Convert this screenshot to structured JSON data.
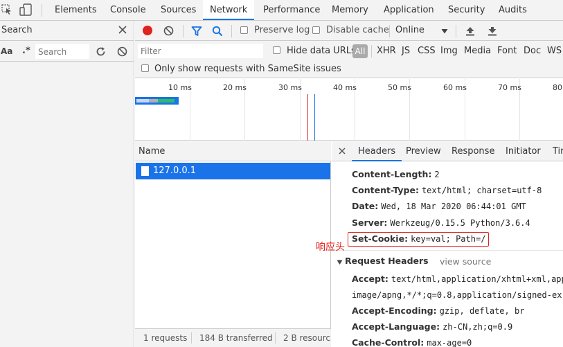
{
  "colors": {
    "accent": "#1a73e8",
    "record": "#e0231e",
    "annotation": "#e0231e",
    "selected_row": "#1a73e8"
  },
  "top_tabs": [
    {
      "label": "Elements"
    },
    {
      "label": "Console"
    },
    {
      "label": "Sources"
    },
    {
      "label": "Network",
      "active": true
    },
    {
      "label": "Performance"
    },
    {
      "label": "Memory"
    },
    {
      "label": "Application"
    },
    {
      "label": "Security"
    },
    {
      "label": "Audits"
    }
  ],
  "search_drawer": {
    "title": "Search",
    "case_toggle": "Aa",
    "regex_toggle": ".*",
    "input_placeholder": "Search"
  },
  "toolbar": {
    "preserve_log": "Preserve log",
    "disable_cache": "Disable cache",
    "throttling": "Online"
  },
  "filter_bar": {
    "filter_placeholder": "Filter",
    "hide_data_urls": "Hide data URLs",
    "types": [
      "All",
      "XHR",
      "JS",
      "CSS",
      "Img",
      "Media",
      "Font",
      "Doc",
      "WS"
    ]
  },
  "samesite_label": "Only show requests with SameSite issues",
  "timeline_ticks": [
    "10 ms",
    "20 ms",
    "30 ms",
    "40 ms",
    "50 ms",
    "60 ms",
    "70 ms",
    "80"
  ],
  "request_list": {
    "column_name": "Name",
    "rows": [
      {
        "name": "127.0.0.1"
      }
    ]
  },
  "status_bar": {
    "requests": "1 requests",
    "transferred": "184 B transferred",
    "resources": "2 B resourc"
  },
  "details": {
    "tabs": [
      "Headers",
      "Preview",
      "Response",
      "Initiator",
      "Tir"
    ],
    "response_headers": [
      {
        "key": "Content-Length:",
        "value": "2"
      },
      {
        "key": "Content-Type:",
        "value": "text/html; charset=utf-8"
      },
      {
        "key": "Date:",
        "value": "Wed, 18 Mar 2020 06:44:01 GMT"
      },
      {
        "key": "Server:",
        "value": "Werkzeug/0.15.5 Python/3.6.4"
      },
      {
        "key": "Set-Cookie:",
        "value": "key=val; Path=/"
      }
    ],
    "request_headers_title": "Request Headers",
    "view_source": "view source",
    "request_headers": [
      {
        "key": "Accept:",
        "value": "text/html,application/xhtml+xml,app"
      },
      {
        "key": "",
        "value": "image/apng,*/*;q=0.8,application/signed-ex"
      },
      {
        "key": "Accept-Encoding:",
        "value": "gzip, deflate, br"
      },
      {
        "key": "Accept-Language:",
        "value": "zh-CN,zh;q=0.9"
      },
      {
        "key": "Cache-Control:",
        "value": "max-age=0"
      }
    ]
  },
  "annotation_label": "响应头"
}
